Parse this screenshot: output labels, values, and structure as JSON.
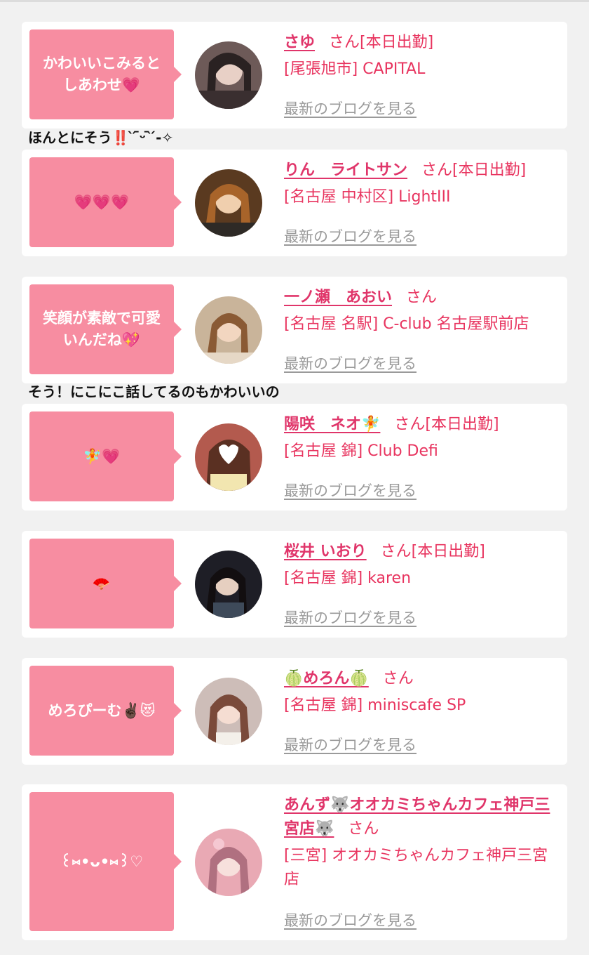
{
  "blog_link_label": "最新のブログを見る",
  "entries": [
    {
      "bubble": "かわいいこみるとしあわせ💗",
      "name": "さゆ",
      "suffix": "さん[本日出勤]",
      "shop": "[尾張旭市] CAPITAL",
      "comment_after": "ほんとにそう‼️ ̀ ᷇ᵕ ᷆ ́-✧"
    },
    {
      "bubble": "💗💗💗",
      "name": "りん　ライトサン",
      "suffix": "さん[本日出勤]",
      "shop": "[名古屋 中村区] LightIII"
    },
    {
      "bubble": "笑顔が素敵で可愛いんだね💖",
      "name": "一ノ瀬　あおい",
      "suffix": "さん",
      "shop": "[名古屋 名駅] C-club 名古屋駅前店",
      "comment_after": "そう！にこにこ話してるのもかわいいの"
    },
    {
      "bubble": "🧚💗",
      "name": "陽咲　ネオ🧚",
      "suffix": "さん[本日出勤]",
      "shop": "[名古屋 錦] Club Defi"
    },
    {
      "bubble": "🪭",
      "name": "桜井 いおり",
      "suffix": "さん[本日出勤]",
      "shop": "[名古屋 錦] karen"
    },
    {
      "bubble": "めろぴーむ✌🏿😻",
      "name": "🍈めろん🍈",
      "suffix": "さん",
      "shop": "[名古屋 錦] miniscafe SP"
    },
    {
      "bubble": "꒰⑅•ᴗ•⑅꒱♡",
      "name": "あんず🐺オオカミちゃんカフェ神戸三宮店🐺",
      "suffix": "さん",
      "shop": "[三宮] オオカミちゃんカフェ神戸三宮店"
    }
  ]
}
